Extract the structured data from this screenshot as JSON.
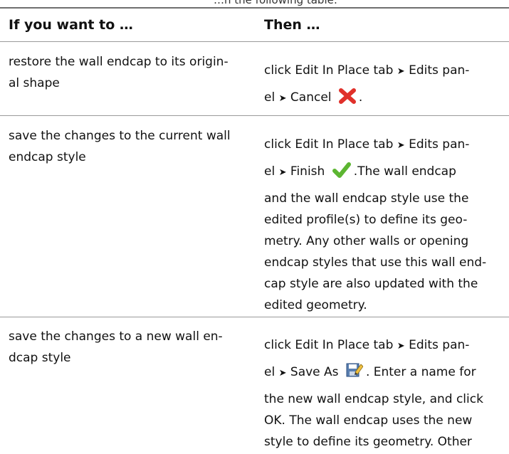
{
  "caption_cut": "…n the following table:",
  "table": {
    "headers": [
      "If you want to …",
      "Then …"
    ],
    "rows": [
      {
        "want": "restore the wall endcap to its origin-al shape",
        "want_lines": [
          "restore the wall endcap to its origin-",
          "al shape"
        ],
        "then_lines": [
          "click Edit In Place tab",
          "Edits pan-",
          "el",
          "Cancel",
          "."
        ],
        "icon": "cancel-x-icon"
      },
      {
        "want_lines": [
          "save the changes to the current wall",
          "endcap style"
        ],
        "then_lines": [
          "click Edit In Place tab",
          "Edits pan-",
          "el",
          "Finish",
          ".The wall endcap",
          "and the wall endcap style use the",
          "edited profile(s) to define its geo-",
          "metry. Any other walls or opening",
          "endcap styles that use this wall end-",
          "cap style are also updated with the",
          "edited geometry."
        ],
        "icon": "finish-check-icon"
      },
      {
        "want_lines": [
          "save the changes to a new wall en-",
          "dcap style"
        ],
        "then_lines": [
          "click Edit In Place tab",
          "Edits pan-",
          "el",
          "Save As",
          ". Enter a name for",
          "the new wall endcap style, and click",
          "OK. The wall endcap uses the new",
          "style to define its geometry. Other"
        ],
        "icon": "save-as-icon"
      }
    ]
  },
  "arrow_glyph": "➤",
  "colors": {
    "rule": "#9a9a9a",
    "check": "#5cb531",
    "cancel": "#e0302a"
  }
}
